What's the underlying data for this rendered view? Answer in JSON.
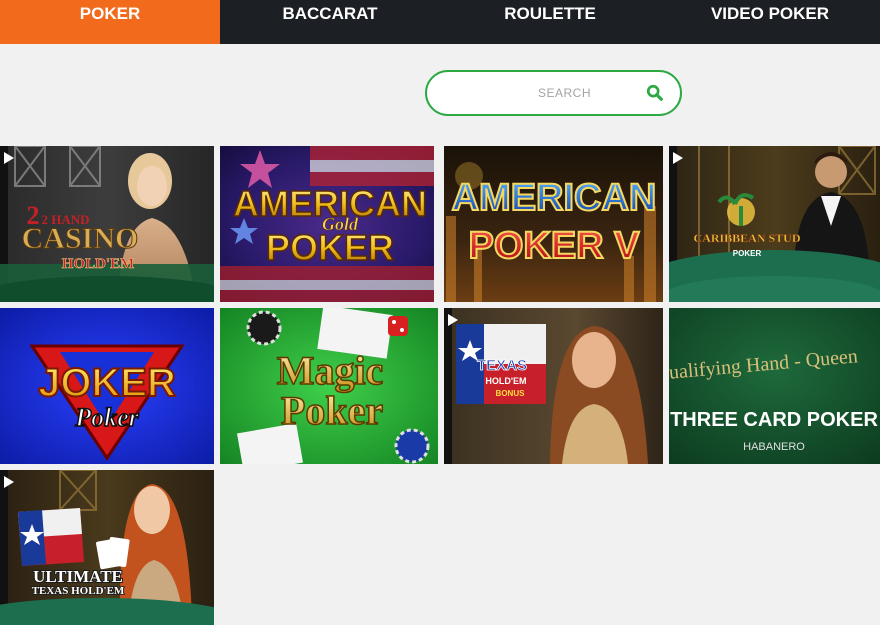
{
  "tabs": [
    {
      "label": "POKER",
      "active": true
    },
    {
      "label": "BACCARAT",
      "active": false
    },
    {
      "label": "ROULETTE",
      "active": false
    },
    {
      "label": "VIDEO POKER",
      "active": false
    }
  ],
  "search": {
    "placeholder": "SEARCH",
    "icon": "search-icon"
  },
  "colors": {
    "accent": "#f26a1b",
    "tabbar": "#1c1f23",
    "search_border": "#2ea843"
  },
  "games": [
    {
      "title_line1": "2 HAND",
      "title_line2": "CASINO",
      "title_line3": "HOLD'EM"
    },
    {
      "title_line1": "AMERICAN",
      "title_line2": "Gold",
      "title_line3": "POKER"
    },
    {
      "title_line1": "AMERICAN",
      "title_line2": "POKER V"
    },
    {
      "title_line1": "CARIBBEAN STUD",
      "title_line2": "POKER"
    },
    {
      "title_line1": "JOKER",
      "title_line2": "Poker"
    },
    {
      "title_line1": "Magic",
      "title_line2": "Poker"
    },
    {
      "title_line1": "TEXAS",
      "title_line2": "HOLD'EM",
      "title_line3": "BONUS"
    },
    {
      "banner": "ualifying Hand - Queen",
      "title": "THREE CARD POKER",
      "provider": "HABANERO"
    },
    {
      "title_line1": "ULTIMATE",
      "title_line2": "TEXAS HOLD'EM"
    }
  ]
}
